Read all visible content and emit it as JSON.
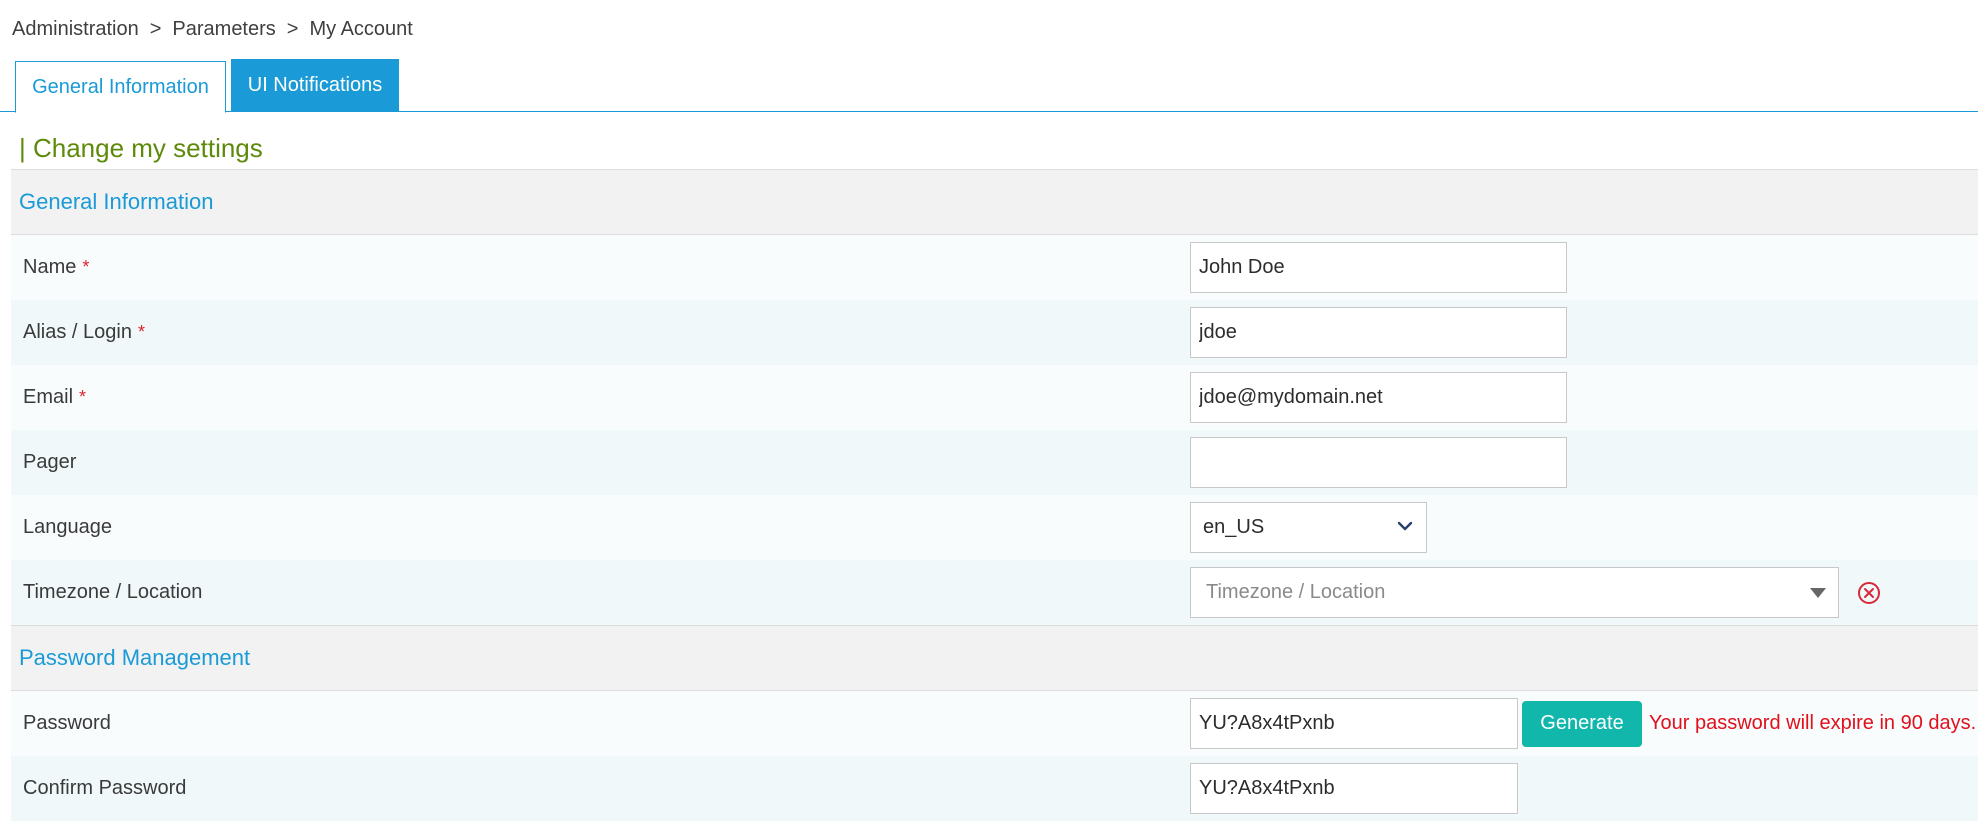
{
  "breadcrumb": {
    "items": [
      "Administration",
      "Parameters",
      "My Account"
    ],
    "separator": ">"
  },
  "tabs": [
    {
      "label": "General Information",
      "active": true
    },
    {
      "label": "UI Notifications",
      "active": false
    }
  ],
  "page_title": "| Change my settings",
  "sections": {
    "general": {
      "header": "General Information",
      "name": {
        "label": "Name",
        "required": "*",
        "value": "John Doe"
      },
      "alias": {
        "label": "Alias / Login",
        "required": "*",
        "value": "jdoe"
      },
      "email": {
        "label": "Email",
        "required": "*",
        "value": "jdoe@mydomain.net"
      },
      "pager": {
        "label": "Pager",
        "value": ""
      },
      "language": {
        "label": "Language",
        "value": "en_US",
        "icon": "chevron-down-icon"
      },
      "timezone": {
        "label": "Timezone / Location",
        "placeholder": "Timezone / Location",
        "clear_icon": "clear-circle-icon"
      }
    },
    "password": {
      "header": "Password Management",
      "password": {
        "label": "Password",
        "value": "YU?A8x4tPxnb"
      },
      "generate_label": "Generate",
      "expire_message": "Your password will expire in 90 days.",
      "confirm": {
        "label": "Confirm Password",
        "value": "YU?A8x4tPxnb"
      }
    }
  },
  "colors": {
    "accent": "#1a9ad6",
    "title_green": "#5e8a0c",
    "required_red": "#e0232c",
    "generate_button": "#11b7ab",
    "warning_red": "#e0101c"
  }
}
